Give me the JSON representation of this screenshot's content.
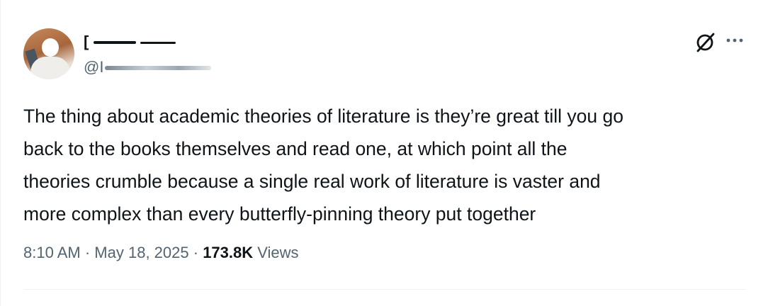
{
  "author": {
    "display_name": "[",
    "handle": "@I"
  },
  "icons": {
    "avatar": "profile-photo",
    "grok": "slashed-circle-icon",
    "more": "ellipsis-icon"
  },
  "tweet": {
    "lines": [
      "The thing about academic theories of literature is they’re great till you go",
      "back to the books themselves and read one, at which point all the",
      "theories crumble because a single real work of literature is vaster and",
      "more complex than every butterfly-pinning theory put together"
    ],
    "time": "8:10 AM",
    "date": "May 18, 2025",
    "views_count": "173.8K",
    "views_label": "Views",
    "separator": "·"
  },
  "colors": {
    "text": "#0f1419",
    "secondary": "#536471",
    "border": "#eff3f4"
  }
}
